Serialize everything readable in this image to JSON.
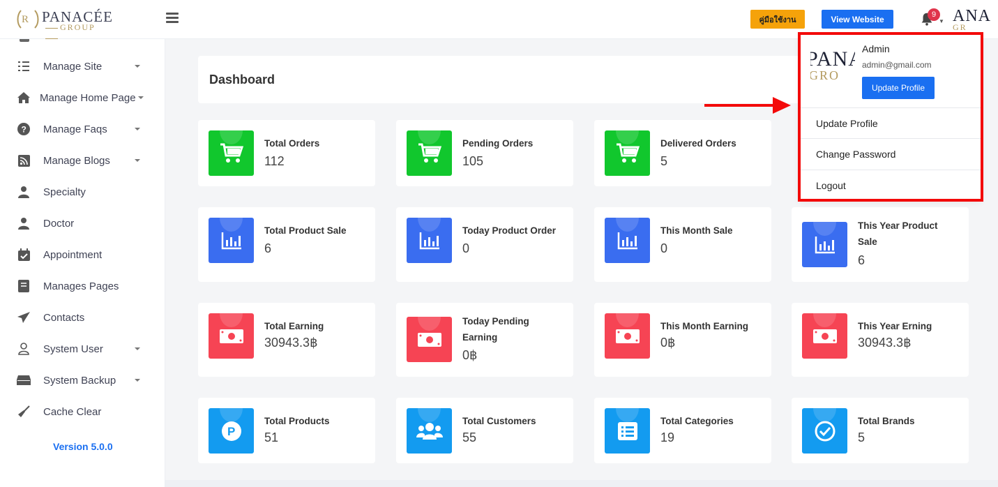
{
  "header": {
    "logo_brand": "PANACÉE",
    "logo_group": "GROUP",
    "manual_button": "คู่มือใช้งาน",
    "website_button": "View Website",
    "notification_count": "9",
    "avatar_brand": "ANA",
    "avatar_group": "GR"
  },
  "sidebar": {
    "items": [
      {
        "label": "Manage Site",
        "icon": "checklist-icon",
        "dropdown": true
      },
      {
        "label": "Manage Home Page",
        "icon": "home-icon",
        "dropdown": true
      },
      {
        "label": "Manage Faqs",
        "icon": "question-icon",
        "dropdown": true
      },
      {
        "label": "Manage Blogs",
        "icon": "rss-icon",
        "dropdown": true
      },
      {
        "label": "Specialty",
        "icon": "doctor-icon",
        "dropdown": false
      },
      {
        "label": "Doctor",
        "icon": "doctor-icon",
        "dropdown": false
      },
      {
        "label": "Appointment",
        "icon": "calendar-check-icon",
        "dropdown": false
      },
      {
        "label": "Manages Pages",
        "icon": "book-icon",
        "dropdown": false
      },
      {
        "label": "Contacts",
        "icon": "paper-plane-icon",
        "dropdown": false
      },
      {
        "label": "System User",
        "icon": "user-icon",
        "dropdown": true
      },
      {
        "label": "System Backup",
        "icon": "hdd-icon",
        "dropdown": true
      },
      {
        "label": "Cache Clear",
        "icon": "broom-icon",
        "dropdown": false
      }
    ],
    "version": "Version 5.0.0"
  },
  "main": {
    "title": "Dashboard",
    "cards": [
      {
        "title": "Total Orders",
        "value": "112",
        "color": "green",
        "icon": "cart-icon"
      },
      {
        "title": "Pending Orders",
        "value": "105",
        "color": "green",
        "icon": "cart-icon"
      },
      {
        "title": "Delivered Orders",
        "value": "5",
        "color": "green",
        "icon": "cart-icon"
      },
      {
        "title": "Total Product Sale",
        "value": "6",
        "color": "blue",
        "icon": "bar-chart-icon"
      },
      {
        "title": "Today Product Order",
        "value": "0",
        "color": "blue",
        "icon": "bar-chart-icon"
      },
      {
        "title": "This Month Sale",
        "value": "0",
        "color": "blue",
        "icon": "bar-chart-icon"
      },
      {
        "title": "This Year Product Sale",
        "value": "6",
        "color": "blue",
        "icon": "bar-chart-icon"
      },
      {
        "title": "Total Earning",
        "value": "30943.3฿",
        "color": "red",
        "icon": "money-bill-icon"
      },
      {
        "title": "Today Pending Earning",
        "value": "0฿",
        "color": "red",
        "icon": "money-bill-icon"
      },
      {
        "title": "This Month Earning",
        "value": "0฿",
        "color": "red",
        "icon": "money-bill-icon"
      },
      {
        "title": "This Year Erning",
        "value": "30943.3฿",
        "color": "red",
        "icon": "money-bill-icon"
      },
      {
        "title": "Total Products",
        "value": "51",
        "color": "sky",
        "icon": "product-p-icon"
      },
      {
        "title": "Total Customers",
        "value": "55",
        "color": "sky",
        "icon": "users-icon"
      },
      {
        "title": "Total Categories",
        "value": "19",
        "color": "sky",
        "icon": "list-icon"
      },
      {
        "title": "Total Brands",
        "value": "5",
        "color": "sky",
        "icon": "check-circle-icon"
      }
    ]
  },
  "profile_dropdown": {
    "logo_brand": "PANA",
    "logo_group": "GRO",
    "name": "Admin",
    "email": "admin@gmail.com",
    "update_button": "Update Profile",
    "menu": [
      "Update Profile",
      "Change Password",
      "Logout"
    ]
  },
  "colors": {
    "green": "#11c72d",
    "blue": "#3a6df0",
    "red": "#f64454",
    "sky": "#139bf0",
    "primary": "#1a6ff1",
    "warning": "#f5a20a",
    "highlight": "#f30a0a"
  }
}
